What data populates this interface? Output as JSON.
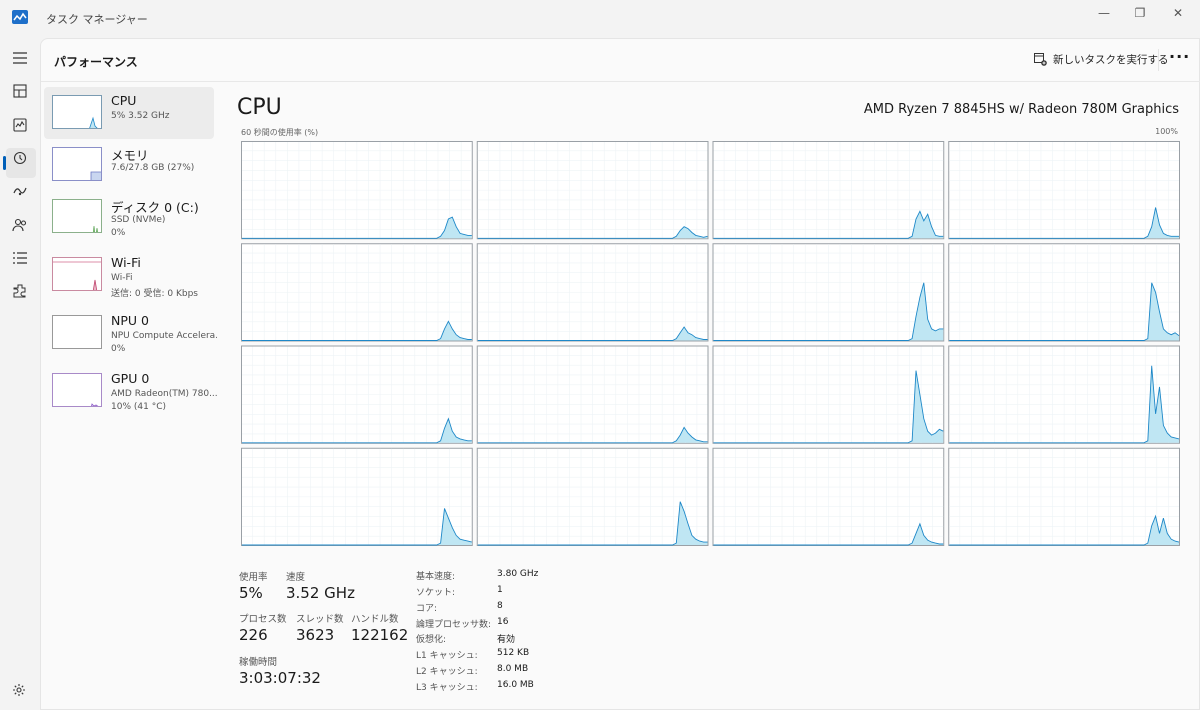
{
  "window": {
    "title": "タスク マネージャー",
    "minimize_glyph": "—",
    "restore_glyph": "❐",
    "close_glyph": "✕"
  },
  "nav": {
    "icons": [
      "hamburger-icon",
      "processes-icon",
      "performance-icon",
      "app-history-icon",
      "startup-icon",
      "users-icon",
      "details-icon",
      "services-icon",
      "settings-icon"
    ]
  },
  "header": {
    "title": "パフォーマンス",
    "run_task_label": "新しいタスクを実行する",
    "more_label": "···"
  },
  "devices": [
    {
      "name": "CPU",
      "sub1": "5%  3.52 GHz",
      "sub2": ""
    },
    {
      "name": "メモリ",
      "sub1": "7.6/27.8 GB (27%)",
      "sub2": ""
    },
    {
      "name": "ディスク 0 (C:)",
      "sub1": "SSD (NVMe)",
      "sub2": "0%"
    },
    {
      "name": "Wi-Fi",
      "sub1": "Wi-Fi",
      "sub2": "送信: 0  受信: 0 Kbps"
    },
    {
      "name": "NPU 0",
      "sub1": "NPU Compute Accelera...",
      "sub2": "0%"
    },
    {
      "name": "GPU 0",
      "sub1": "AMD Radeon(TM) 780...",
      "sub2": "10%  (41 °C)"
    }
  ],
  "cpu": {
    "title": "CPU",
    "model": "AMD Ryzen 7 8845HS w/ Radeon 780M Graphics",
    "graph_label": "60 秒間の使用率 (%)",
    "graph_max": "100%",
    "accent_color": "#1e88c8",
    "fill_color": "#bfe6f3"
  },
  "stats": {
    "usage_label": "使用率",
    "usage": "5%",
    "speed_label": "速度",
    "speed": "3.52 GHz",
    "processes_label": "プロセス数",
    "processes": "226",
    "threads_label": "スレッド数",
    "threads": "3623",
    "handles_label": "ハンドル数",
    "handles": "122162",
    "uptime_label": "稼働時間",
    "uptime": "3:03:07:32"
  },
  "specs": [
    {
      "label": "基本速度:",
      "value": "3.80 GHz"
    },
    {
      "label": "ソケット:",
      "value": "1"
    },
    {
      "label": "コア:",
      "value": "8"
    },
    {
      "label": "論理プロセッサ数:",
      "value": "16"
    },
    {
      "label": "仮想化:",
      "value": "有効"
    },
    {
      "label": "L1 キャッシュ:",
      "value": "512 KB"
    },
    {
      "label": "L2 キャッシュ:",
      "value": "8.0 MB"
    },
    {
      "label": "L3 キャッシュ:",
      "value": "16.0 MB"
    }
  ],
  "chart_data": {
    "type": "area",
    "title": "",
    "xlabel": "",
    "ylabel": "",
    "ylim": [
      0,
      100
    ],
    "x_count": 60,
    "series": [
      {
        "values": [
          0,
          0,
          0,
          0,
          0,
          0,
          0,
          0,
          0,
          0,
          0,
          0,
          0,
          0,
          0,
          0,
          0,
          0,
          0,
          0,
          0,
          0,
          0,
          0,
          0,
          0,
          0,
          0,
          0,
          0,
          0,
          0,
          0,
          0,
          0,
          0,
          0,
          0,
          0,
          0,
          0,
          0,
          0,
          0,
          0,
          0,
          0,
          0,
          0,
          0,
          0,
          2,
          8,
          20,
          22,
          12,
          5,
          4,
          3,
          3
        ]
      },
      {
        "values": [
          0,
          0,
          0,
          0,
          0,
          0,
          0,
          0,
          0,
          0,
          0,
          0,
          0,
          0,
          0,
          0,
          0,
          0,
          0,
          0,
          0,
          0,
          0,
          0,
          0,
          0,
          0,
          0,
          0,
          0,
          0,
          0,
          0,
          0,
          0,
          0,
          0,
          0,
          0,
          0,
          0,
          0,
          0,
          0,
          0,
          0,
          0,
          0,
          0,
          0,
          0,
          2,
          8,
          12,
          10,
          6,
          3,
          2,
          1,
          2
        ]
      },
      {
        "values": [
          0,
          0,
          0,
          0,
          0,
          0,
          0,
          0,
          0,
          0,
          0,
          0,
          0,
          0,
          0,
          0,
          0,
          0,
          0,
          0,
          0,
          0,
          0,
          0,
          0,
          0,
          0,
          0,
          0,
          0,
          0,
          0,
          0,
          0,
          0,
          0,
          0,
          0,
          0,
          0,
          0,
          0,
          0,
          0,
          0,
          0,
          0,
          0,
          0,
          0,
          0,
          2,
          20,
          28,
          18,
          25,
          12,
          3,
          2,
          2
        ]
      },
      {
        "values": [
          0,
          0,
          0,
          0,
          0,
          0,
          0,
          0,
          0,
          0,
          0,
          0,
          0,
          0,
          0,
          0,
          0,
          0,
          0,
          0,
          0,
          0,
          0,
          0,
          0,
          0,
          0,
          0,
          0,
          0,
          0,
          0,
          0,
          0,
          0,
          0,
          0,
          0,
          0,
          0,
          0,
          0,
          0,
          0,
          0,
          0,
          0,
          0,
          0,
          0,
          0,
          2,
          12,
          32,
          14,
          5,
          3,
          2,
          2,
          2
        ]
      },
      {
        "values": [
          0,
          0,
          0,
          0,
          0,
          0,
          0,
          0,
          0,
          0,
          0,
          0,
          0,
          0,
          0,
          0,
          0,
          0,
          0,
          0,
          0,
          0,
          0,
          0,
          0,
          0,
          0,
          0,
          0,
          0,
          0,
          0,
          0,
          0,
          0,
          0,
          0,
          0,
          0,
          0,
          0,
          0,
          0,
          0,
          0,
          0,
          0,
          0,
          0,
          0,
          0,
          2,
          12,
          20,
          12,
          6,
          3,
          2,
          1,
          1
        ]
      },
      {
        "values": [
          0,
          0,
          0,
          0,
          0,
          0,
          0,
          0,
          0,
          0,
          0,
          0,
          0,
          0,
          0,
          0,
          0,
          0,
          0,
          0,
          0,
          0,
          0,
          0,
          0,
          0,
          0,
          0,
          0,
          0,
          0,
          0,
          0,
          0,
          0,
          0,
          0,
          0,
          0,
          0,
          0,
          0,
          0,
          0,
          0,
          0,
          0,
          0,
          0,
          0,
          0,
          2,
          8,
          14,
          8,
          6,
          3,
          2,
          1,
          1
        ]
      },
      {
        "values": [
          0,
          0,
          0,
          0,
          0,
          0,
          0,
          0,
          0,
          0,
          0,
          0,
          0,
          0,
          0,
          0,
          0,
          0,
          0,
          0,
          0,
          0,
          0,
          0,
          0,
          0,
          0,
          0,
          0,
          0,
          0,
          0,
          0,
          0,
          0,
          0,
          0,
          0,
          0,
          0,
          0,
          0,
          0,
          0,
          0,
          0,
          0,
          0,
          0,
          0,
          0,
          2,
          25,
          45,
          60,
          22,
          12,
          10,
          12,
          12
        ]
      },
      {
        "values": [
          0,
          0,
          0,
          0,
          0,
          0,
          0,
          0,
          0,
          0,
          0,
          0,
          0,
          0,
          0,
          0,
          0,
          0,
          0,
          0,
          0,
          0,
          0,
          0,
          0,
          0,
          0,
          0,
          0,
          0,
          0,
          0,
          0,
          0,
          0,
          0,
          0,
          0,
          0,
          0,
          0,
          0,
          0,
          0,
          0,
          0,
          0,
          0,
          0,
          0,
          0,
          2,
          60,
          50,
          30,
          12,
          8,
          6,
          8,
          5
        ]
      },
      {
        "values": [
          0,
          0,
          0,
          0,
          0,
          0,
          0,
          0,
          0,
          0,
          0,
          0,
          0,
          0,
          0,
          0,
          0,
          0,
          0,
          0,
          0,
          0,
          0,
          0,
          0,
          0,
          0,
          0,
          0,
          0,
          0,
          0,
          0,
          0,
          0,
          0,
          0,
          0,
          0,
          0,
          0,
          0,
          0,
          0,
          0,
          0,
          0,
          0,
          0,
          0,
          0,
          2,
          15,
          25,
          12,
          6,
          4,
          3,
          2,
          2
        ]
      },
      {
        "values": [
          0,
          0,
          0,
          0,
          0,
          0,
          0,
          0,
          0,
          0,
          0,
          0,
          0,
          0,
          0,
          0,
          0,
          0,
          0,
          0,
          0,
          0,
          0,
          0,
          0,
          0,
          0,
          0,
          0,
          0,
          0,
          0,
          0,
          0,
          0,
          0,
          0,
          0,
          0,
          0,
          0,
          0,
          0,
          0,
          0,
          0,
          0,
          0,
          0,
          0,
          0,
          2,
          8,
          16,
          10,
          6,
          3,
          2,
          1,
          1
        ]
      },
      {
        "values": [
          0,
          0,
          0,
          0,
          0,
          0,
          0,
          0,
          0,
          0,
          0,
          0,
          0,
          0,
          0,
          0,
          0,
          0,
          0,
          0,
          0,
          0,
          0,
          0,
          0,
          0,
          0,
          0,
          0,
          0,
          0,
          0,
          0,
          0,
          0,
          0,
          0,
          0,
          0,
          0,
          0,
          0,
          0,
          0,
          0,
          0,
          0,
          0,
          0,
          0,
          0,
          2,
          75,
          50,
          25,
          12,
          8,
          10,
          14,
          12
        ]
      },
      {
        "values": [
          0,
          0,
          0,
          0,
          0,
          0,
          0,
          0,
          0,
          0,
          0,
          0,
          0,
          0,
          0,
          0,
          0,
          0,
          0,
          0,
          0,
          0,
          0,
          0,
          0,
          0,
          0,
          0,
          0,
          0,
          0,
          0,
          0,
          0,
          0,
          0,
          0,
          0,
          0,
          0,
          0,
          0,
          0,
          0,
          0,
          0,
          0,
          0,
          0,
          0,
          0,
          2,
          80,
          30,
          58,
          18,
          10,
          6,
          5,
          4
        ]
      },
      {
        "values": [
          0,
          0,
          0,
          0,
          0,
          0,
          0,
          0,
          0,
          0,
          0,
          0,
          0,
          0,
          0,
          0,
          0,
          0,
          0,
          0,
          0,
          0,
          0,
          0,
          0,
          0,
          0,
          0,
          0,
          0,
          0,
          0,
          0,
          0,
          0,
          0,
          0,
          0,
          0,
          0,
          0,
          0,
          0,
          0,
          0,
          0,
          0,
          0,
          0,
          0,
          0,
          2,
          38,
          28,
          18,
          10,
          6,
          5,
          4,
          3
        ]
      },
      {
        "values": [
          0,
          0,
          0,
          0,
          0,
          0,
          0,
          0,
          0,
          0,
          0,
          0,
          0,
          0,
          0,
          0,
          0,
          0,
          0,
          0,
          0,
          0,
          0,
          0,
          0,
          0,
          0,
          0,
          0,
          0,
          0,
          0,
          0,
          0,
          0,
          0,
          0,
          0,
          0,
          0,
          0,
          0,
          0,
          0,
          0,
          0,
          0,
          0,
          0,
          0,
          0,
          2,
          45,
          35,
          22,
          10,
          6,
          4,
          3,
          3
        ]
      },
      {
        "values": [
          0,
          0,
          0,
          0,
          0,
          0,
          0,
          0,
          0,
          0,
          0,
          0,
          0,
          0,
          0,
          0,
          0,
          0,
          0,
          0,
          0,
          0,
          0,
          0,
          0,
          0,
          0,
          0,
          0,
          0,
          0,
          0,
          0,
          0,
          0,
          0,
          0,
          0,
          0,
          0,
          0,
          0,
          0,
          0,
          0,
          0,
          0,
          0,
          0,
          0,
          0,
          2,
          12,
          22,
          10,
          5,
          3,
          2,
          1,
          1
        ]
      },
      {
        "values": [
          0,
          0,
          0,
          0,
          0,
          0,
          0,
          0,
          0,
          0,
          0,
          0,
          0,
          0,
          0,
          0,
          0,
          0,
          0,
          0,
          0,
          0,
          0,
          0,
          0,
          0,
          0,
          0,
          0,
          0,
          0,
          0,
          0,
          0,
          0,
          0,
          0,
          0,
          0,
          0,
          0,
          0,
          0,
          0,
          0,
          0,
          0,
          0,
          0,
          0,
          0,
          2,
          20,
          30,
          12,
          28,
          12,
          6,
          4,
          3
        ]
      }
    ]
  }
}
